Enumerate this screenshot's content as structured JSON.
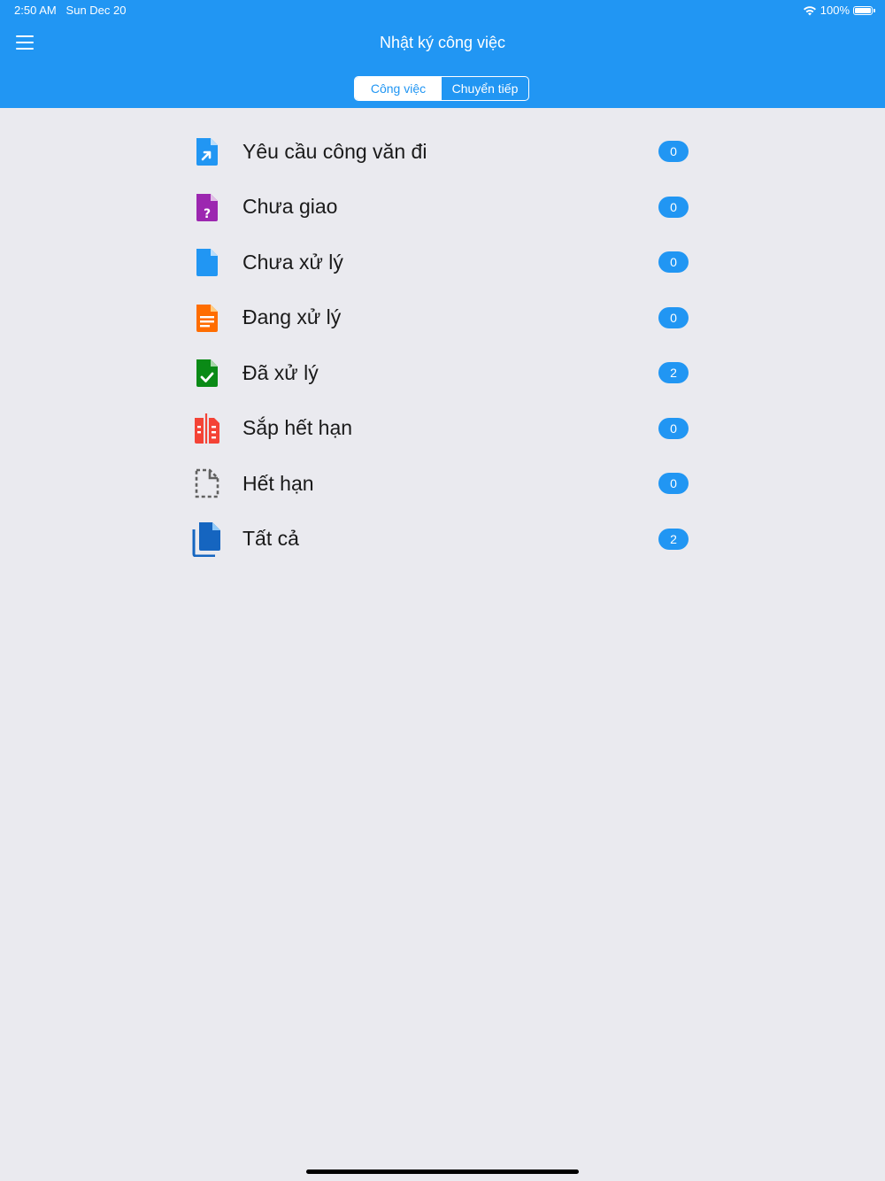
{
  "status_bar": {
    "time": "2:50 AM",
    "date": "Sun Dec 20",
    "battery": "100%"
  },
  "header": {
    "title": "Nhật ký công việc",
    "menu_icon": "hamburger-menu-icon",
    "tabs": [
      {
        "label": "Công việc",
        "selected": true
      },
      {
        "label": "Chuyển tiếp",
        "selected": false
      }
    ]
  },
  "accent_color": "#2196f3",
  "items": [
    {
      "label": "Yêu cầu công văn đi",
      "count": "0",
      "icon": "outgoing-document-icon",
      "color": "#2196f3"
    },
    {
      "label": "Chưa giao",
      "count": "0",
      "icon": "unassigned-document-icon",
      "color": "#9c27b0"
    },
    {
      "label": "Chưa xử lý",
      "count": "0",
      "icon": "unprocessed-document-icon",
      "color": "#2196f3"
    },
    {
      "label": "Đang xử lý",
      "count": "0",
      "icon": "processing-document-icon",
      "color": "#ff6d00"
    },
    {
      "label": "Đã xử lý",
      "count": "2",
      "icon": "processed-document-icon",
      "color": "#0a8a16"
    },
    {
      "label": "Sắp hết hạn",
      "count": "0",
      "icon": "expiring-document-icon",
      "color": "#f44336"
    },
    {
      "label": "Hết hạn",
      "count": "0",
      "icon": "expired-document-icon",
      "color": "#616161"
    },
    {
      "label": "Tất cả",
      "count": "2",
      "icon": "all-documents-icon",
      "color": "#1565c0"
    }
  ]
}
